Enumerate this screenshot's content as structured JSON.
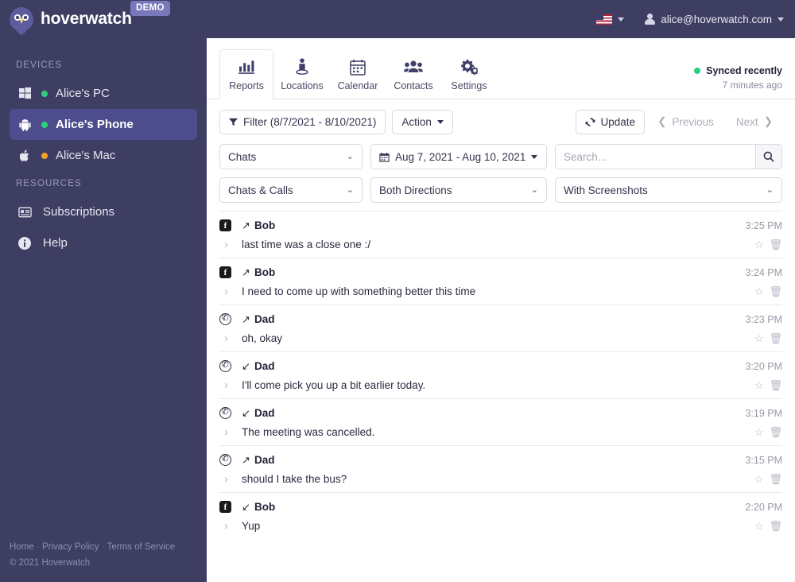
{
  "header": {
    "brand": "hoverwatch",
    "badge": "DEMO",
    "language_icon": "us-flag-icon",
    "user_email": "alice@hoverwatch.com"
  },
  "sidebar": {
    "devices_heading": "DEVICES",
    "devices": [
      {
        "label": "Alice's PC",
        "icon": "windows-icon",
        "status": "green"
      },
      {
        "label": "Alice's Phone",
        "icon": "android-icon",
        "status": "green",
        "active": true
      },
      {
        "label": "Alice's Mac",
        "icon": "apple-icon",
        "status": "orange"
      }
    ],
    "resources_heading": "RESOURCES",
    "resources": [
      {
        "label": "Subscriptions",
        "icon": "subscriptions-icon"
      },
      {
        "label": "Help",
        "icon": "info-icon"
      }
    ],
    "footer": {
      "links": [
        "Home",
        "Privacy Policy",
        "Terms of Service"
      ],
      "separator": "·",
      "copyright": "© 2021 Hoverwatch"
    }
  },
  "tabs": [
    {
      "label": "Reports",
      "icon": "bar-chart-icon",
      "active": true
    },
    {
      "label": "Locations",
      "icon": "person-pin-icon",
      "active": false
    },
    {
      "label": "Calendar",
      "icon": "calendar-icon",
      "active": false
    },
    {
      "label": "Contacts",
      "icon": "users-icon",
      "active": false
    },
    {
      "label": "Settings",
      "icon": "gears-icon",
      "active": false
    }
  ],
  "sync": {
    "status": "Synced recently",
    "time_ago": "7 minutes ago",
    "status_color": "#2fce7f"
  },
  "toolbar": {
    "filter_label": "Filter (8/7/2021 - 8/10/2021)",
    "action_label": "Action",
    "update_label": "Update",
    "previous_label": "Previous",
    "next_label": "Next"
  },
  "filters": {
    "type_select": "Chats",
    "date_range": "Aug 7, 2021 - Aug 10, 2021",
    "search_placeholder": "Search...",
    "search_value": "",
    "category_select": "Chats & Calls",
    "direction_select": "Both Directions",
    "screenshots_select": "With Screenshots"
  },
  "messages": [
    {
      "app": "facebook-icon",
      "direction": "outgoing",
      "name": "Bob",
      "time": "3:25 PM",
      "text": "last time was a close one :/"
    },
    {
      "app": "facebook-icon",
      "direction": "outgoing",
      "name": "Bob",
      "time": "3:24 PM",
      "text": "I need to come up with something better this time"
    },
    {
      "app": "whatsapp-icon",
      "direction": "outgoing",
      "name": "Dad",
      "time": "3:23 PM",
      "text": "oh, okay"
    },
    {
      "app": "whatsapp-icon",
      "direction": "incoming",
      "name": "Dad",
      "time": "3:20 PM",
      "text": "I'll come pick you up a bit earlier today."
    },
    {
      "app": "whatsapp-icon",
      "direction": "incoming",
      "name": "Dad",
      "time": "3:19 PM",
      "text": "The meeting was cancelled."
    },
    {
      "app": "whatsapp-icon",
      "direction": "outgoing",
      "name": "Dad",
      "time": "3:15 PM",
      "text": "should I take the bus?"
    },
    {
      "app": "facebook-icon",
      "direction": "incoming",
      "name": "Bob",
      "time": "2:20 PM",
      "text": "Yup"
    }
  ],
  "glyphs": {
    "outgoing": "↗",
    "incoming": "↙",
    "row_chevron": "›",
    "star": "☆",
    "trash": "🗑",
    "select_chevron": "⌄"
  },
  "colors": {
    "sidebar": "#3e3e63",
    "sidebar_active": "#4d4d8e",
    "badge": "#7878bd",
    "green": "#2fce7f",
    "orange": "#f0a32a"
  }
}
